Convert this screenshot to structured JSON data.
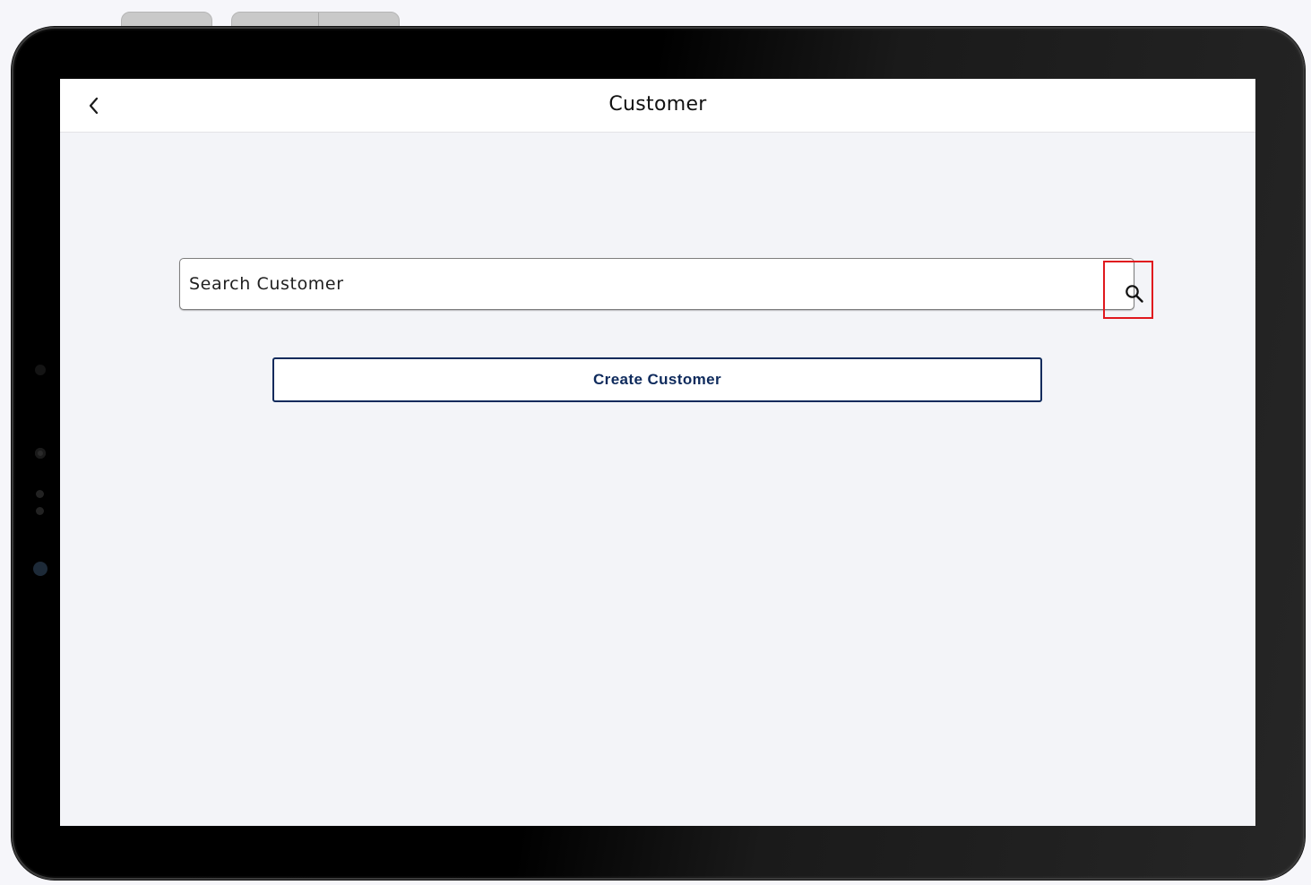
{
  "header": {
    "title": "Customer",
    "back_icon": "chevron-left-icon"
  },
  "search": {
    "placeholder": "Search Customer",
    "value": "",
    "icon": "search-icon",
    "highlight_color": "#e0181e"
  },
  "actions": {
    "create_label": "Create Customer",
    "create_color": "#0e2a5c"
  },
  "colors": {
    "screen_background": "#f3f4f8",
    "app_bar_background": "#ffffff"
  }
}
